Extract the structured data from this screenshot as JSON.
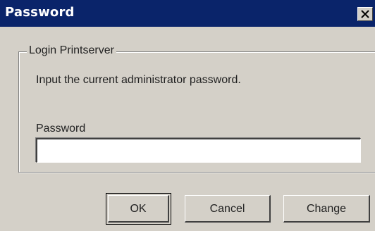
{
  "window": {
    "title": "Password",
    "close_icon": "close-icon"
  },
  "group": {
    "legend": "Login Printserver",
    "instruction": "Input the current administrator password."
  },
  "password_field": {
    "label": "Password",
    "value": ""
  },
  "buttons": {
    "ok": "OK",
    "cancel": "Cancel",
    "change": "Change"
  },
  "colors": {
    "titlebar": "#0a246a",
    "face": "#d4d0c8"
  }
}
